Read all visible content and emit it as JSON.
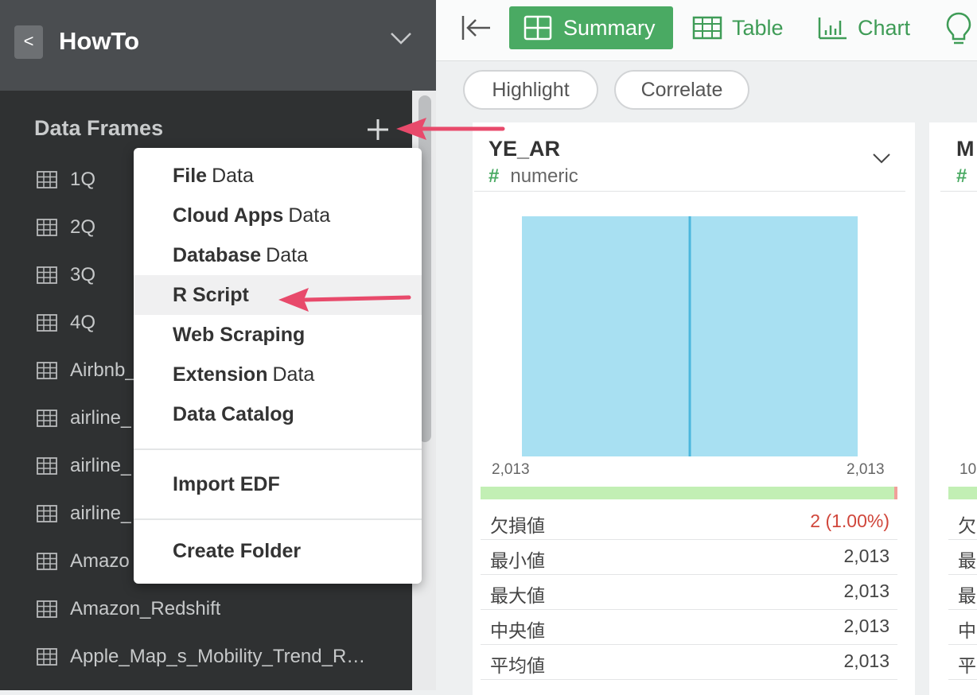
{
  "sidebar": {
    "project_title": "HowTo",
    "back_label": "<",
    "data_frames_heading": "Data Frames",
    "items": [
      {
        "label": "1Q"
      },
      {
        "label": "2Q"
      },
      {
        "label": "3Q"
      },
      {
        "label": "4Q"
      },
      {
        "label": "Airbnb_"
      },
      {
        "label": "airline_"
      },
      {
        "label": "airline_"
      },
      {
        "label": "airline_"
      },
      {
        "label": "Amazo"
      },
      {
        "label": "Amazon_Redshift"
      },
      {
        "label": "Apple_Map_s_Mobility_Trend_R…"
      }
    ]
  },
  "toolbar": {
    "tabs": [
      {
        "label": "Summary",
        "icon": "grid-icon",
        "active": true
      },
      {
        "label": "Table",
        "icon": "table-icon"
      },
      {
        "label": "Chart",
        "icon": "bar-chart-icon"
      }
    ],
    "pills": [
      "Highlight",
      "Correlate"
    ]
  },
  "card": {
    "column_name": "YE_AR",
    "type_symbol": "#",
    "type": "numeric",
    "hist_min": "2,013",
    "hist_max": "2,013",
    "missing_fraction": 0.01,
    "stats": [
      {
        "key": "欠損値",
        "value": "2 (1.00%)",
        "warn": true
      },
      {
        "key": "最小値",
        "value": "2,013"
      },
      {
        "key": "最大値",
        "value": "2,013"
      },
      {
        "key": "中央値",
        "value": "2,013"
      },
      {
        "key": "平均値",
        "value": "2,013"
      }
    ]
  },
  "card2": {
    "name_fragment": "M",
    "type_symbol": "#",
    "tick_fragment": "10",
    "stat_fragments": [
      "欠",
      "最",
      "最",
      "中",
      "平"
    ]
  },
  "dropdown": {
    "items": [
      {
        "bold": "File",
        "rest": "Data"
      },
      {
        "bold": "Cloud Apps",
        "rest": "Data"
      },
      {
        "bold": "Database",
        "rest": "Data"
      },
      {
        "bold": "R Script",
        "rest": "",
        "highlighted": true
      },
      {
        "bold": "Web Scraping",
        "rest": ""
      },
      {
        "bold": "Extension",
        "rest": "Data"
      },
      {
        "bold": "Data Catalog",
        "rest": ""
      },
      {
        "bold": "Import EDF",
        "rest": ""
      },
      {
        "bold": "Create Folder",
        "rest": ""
      }
    ]
  },
  "colors": {
    "accent": "#4aaa63",
    "annotation_arrow": "#e84a6b",
    "histogram": "#a8e0f2",
    "warn": "#d0463b"
  }
}
